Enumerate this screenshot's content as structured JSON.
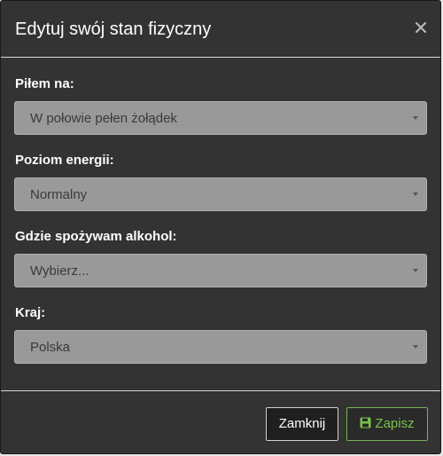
{
  "modal": {
    "title": "Edytuj swój stan fizyczny",
    "close_icon": "close-icon"
  },
  "fields": [
    {
      "label": "Piłem na:",
      "value": "W połowie pełen żołądek"
    },
    {
      "label": "Poziom energii:",
      "value": "Normalny"
    },
    {
      "label": "Gdzie spożywam alkohol:",
      "value": "Wybierz..."
    },
    {
      "label": "Kraj:",
      "value": "Polska"
    }
  ],
  "footer": {
    "close_label": "Zamknij",
    "save_label": "Zapisz",
    "save_icon": "floppy-disk-icon"
  },
  "colors": {
    "modal_bg": "#333333",
    "select_bg": "#999999",
    "save_accent": "#77c24a"
  }
}
